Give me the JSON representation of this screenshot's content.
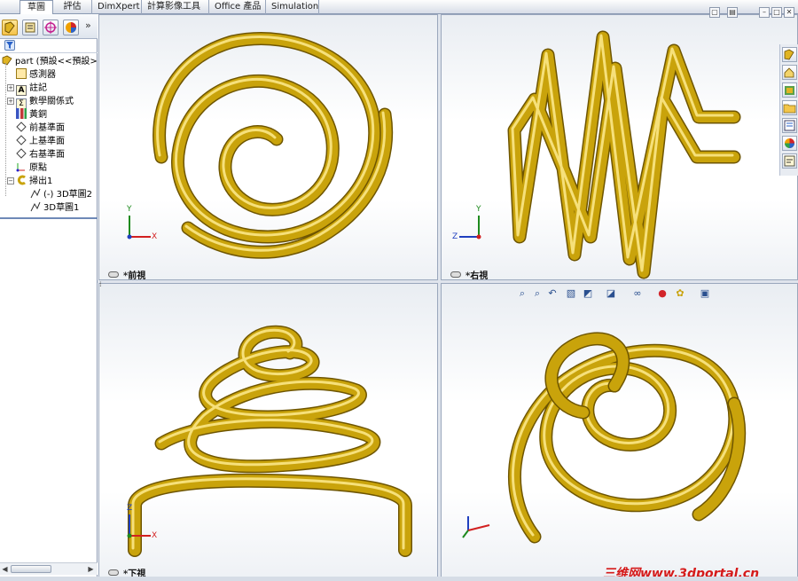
{
  "tabs": [
    {
      "label": "草圖",
      "active": true
    },
    {
      "label": "評估",
      "active": false
    },
    {
      "label": "DimXpert",
      "active": false
    },
    {
      "label": "計算影像工具",
      "active": false
    },
    {
      "label": "Office 產品",
      "active": false
    },
    {
      "label": "Simulation",
      "active": false
    }
  ],
  "feature_tree": {
    "toolbar_icons": [
      "feature-manager-icon",
      "property-manager-icon",
      "configuration-manager-icon",
      "display-manager-icon"
    ],
    "more_label": "»",
    "root": "part (預設<<預設>",
    "items": [
      {
        "label": "感測器",
        "icon": "sensor-icon",
        "expandable": false
      },
      {
        "label": "註記",
        "icon": "annotation-icon",
        "expandable": true
      },
      {
        "label": "數學關係式",
        "icon": "equation-icon",
        "expandable": true
      },
      {
        "label": "黃銅",
        "icon": "material-icon",
        "expandable": false
      },
      {
        "label": "前基準面",
        "icon": "plane-icon",
        "expandable": false
      },
      {
        "label": "上基準面",
        "icon": "plane-icon",
        "expandable": false
      },
      {
        "label": "右基準面",
        "icon": "plane-icon",
        "expandable": false
      },
      {
        "label": "原點",
        "icon": "origin-icon",
        "expandable": false
      },
      {
        "label": "掃出1",
        "icon": "sweep-icon",
        "expandable": true
      },
      {
        "label": "(-) 3D草圖2",
        "icon": "sketch3d-icon",
        "expandable": false
      },
      {
        "label": "3D草圖1",
        "icon": "sketch3d-icon",
        "expandable": false
      }
    ]
  },
  "viewports": [
    {
      "id": "front",
      "label": "*前視",
      "triad": {
        "up": "Y",
        "right": "X"
      }
    },
    {
      "id": "right",
      "label": "*右視",
      "triad": {
        "up": "Y",
        "right": "Z"
      }
    },
    {
      "id": "bottom",
      "label": "*下視",
      "triad": {
        "up": "Z",
        "right": "X"
      }
    },
    {
      "id": "iso",
      "label": "",
      "triad": {
        "up": "",
        "right": ""
      }
    }
  ],
  "colors": {
    "spring": "#c9a30b",
    "spring_highlight": "#fff0a0",
    "spring_shadow": "#6e5500",
    "axis_x": "#d22020",
    "axis_y": "#1e8a1e",
    "axis_z": "#1f3fbf",
    "watermark": "#d51a1a"
  },
  "heads_up_icons": [
    "zoom-fit-icon",
    "zoom-area-icon",
    "previous-view-icon",
    "section-view-icon",
    "view-orientation-icon",
    "display-style-icon",
    "hide-show-icon",
    "edit-appearance-icon",
    "apply-scene-icon",
    "view-settings-icon"
  ],
  "task_pane_icons": [
    "resources-icon",
    "design-library-icon",
    "file-explorer-icon",
    "search-icon",
    "view-palette-icon",
    "appearances-icon",
    "custom-properties-icon"
  ],
  "watermark": "三维网www.3dportal.cn"
}
